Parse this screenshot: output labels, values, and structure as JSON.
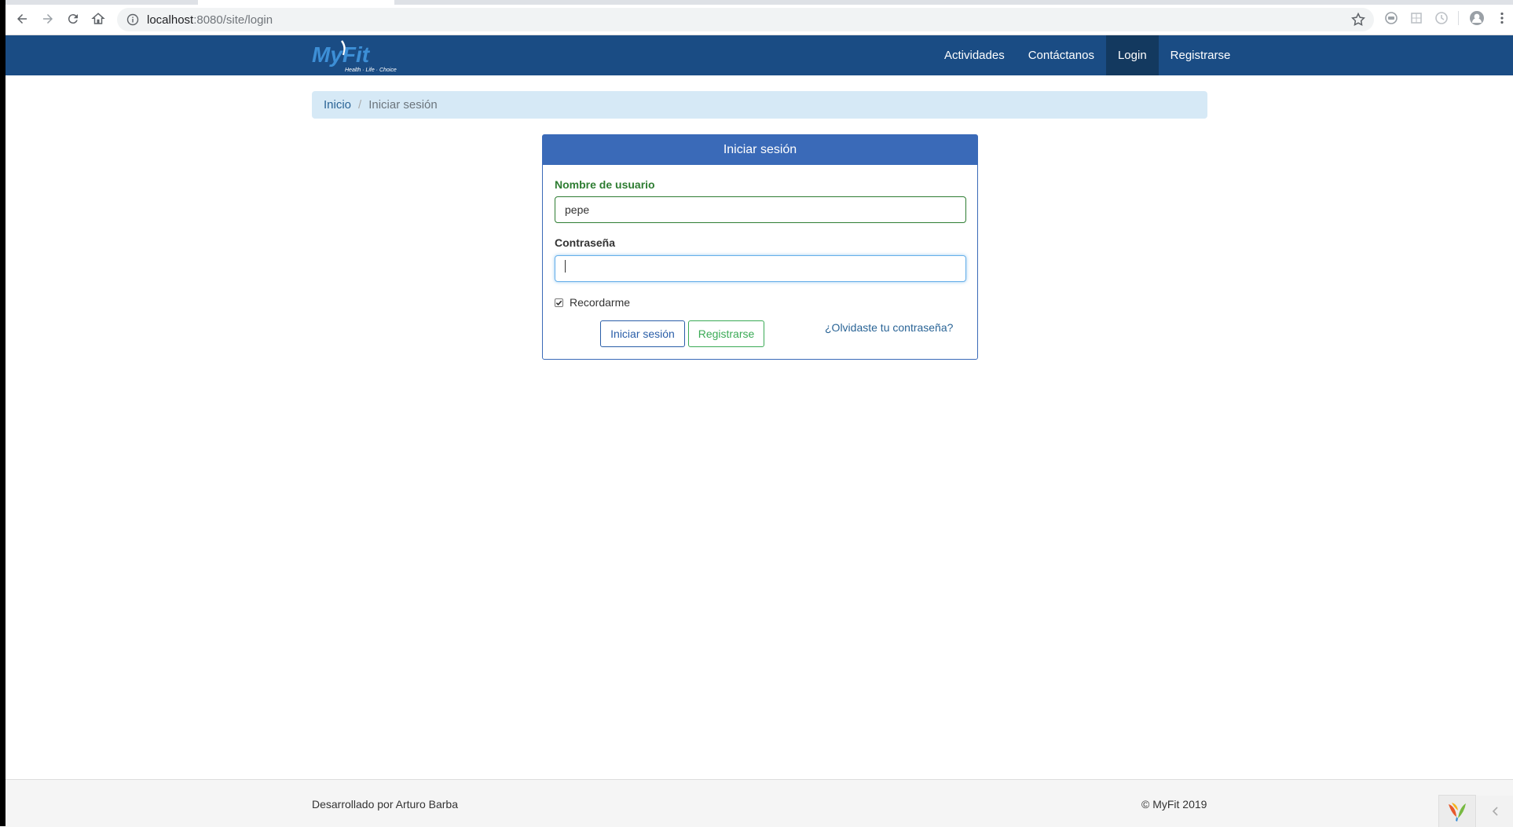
{
  "browser": {
    "url_host": "localhost",
    "url_path": ":8080/site/login"
  },
  "navbar": {
    "brand": "MyFit",
    "tagline": "Health · Life · Choice",
    "items": [
      {
        "label": "Actividades"
      },
      {
        "label": "Contáctanos"
      },
      {
        "label": "Login"
      },
      {
        "label": "Registrarse"
      }
    ],
    "colors": {
      "bar": "#1a4c84",
      "active": "#13395f"
    }
  },
  "breadcrumb": {
    "home": "Inicio",
    "current": "Iniciar sesión"
  },
  "login": {
    "title": "Iniciar sesión",
    "username_label": "Nombre de usuario",
    "username_value": "pepe",
    "password_label": "Contraseña",
    "password_value": "",
    "remember_label": "Recordarme",
    "remember_checked": true,
    "submit_label": "Iniciar sesión",
    "register_label": "Registrarse",
    "forgot_label": "¿Olvidaste tu contraseña?",
    "colors": {
      "header": "#3a6ab8",
      "valid": "#2e7d32",
      "success": "#3aaa55"
    }
  },
  "footer": {
    "credit": "Desarrollado por Arturo Barba",
    "copyright": "© MyFit 2019"
  }
}
